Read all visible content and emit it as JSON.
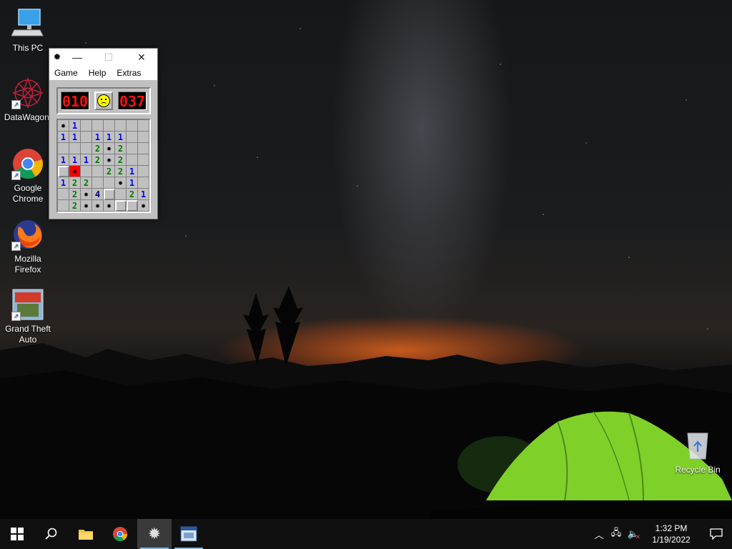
{
  "desktop": {
    "icons": [
      {
        "label": "This PC",
        "icon": "computer-icon"
      },
      {
        "label": "DataWagon.",
        "icon": "datawagon-icon"
      },
      {
        "label": "Google Chrome",
        "icon": "chrome-icon"
      },
      {
        "label": "Mozilla Firefox",
        "icon": "firefox-icon"
      },
      {
        "label": "Grand Theft Auto",
        "icon": "gta-icon"
      }
    ],
    "recycle_bin": {
      "label": "Recycle Bin",
      "icon": "recycle-bin-icon"
    }
  },
  "minesweeper": {
    "menu": [
      "Game",
      "Help",
      "Extras"
    ],
    "mines_counter": "010",
    "timer": "037",
    "face_state": "dead",
    "grid": [
      [
        "*",
        "1",
        "",
        "",
        "",
        "",
        "",
        ""
      ],
      [
        "1",
        "1",
        "",
        "1",
        "1",
        "1",
        "",
        ""
      ],
      [
        "",
        "",
        "",
        "2",
        "*",
        "2",
        "",
        ""
      ],
      [
        "1",
        "1",
        "1",
        "2",
        "*",
        "2",
        "",
        ""
      ],
      [
        "#",
        "X",
        "",
        "",
        "2",
        "2",
        "1",
        ""
      ],
      [
        "1",
        "2",
        "2",
        "",
        "",
        "*",
        "1",
        ""
      ],
      [
        "",
        "2",
        "*",
        "4",
        "#",
        "",
        "2",
        "1"
      ],
      [
        "",
        "2",
        "*",
        "*",
        "*",
        "#",
        "#",
        "*"
      ]
    ]
  },
  "taskbar": {
    "tray": {
      "time": "1:32 PM",
      "date": "1/19/2022"
    }
  },
  "colors": {
    "lcd_digits": "#ff1010",
    "exploded_cell": "#ff0000",
    "tent_green": "#7fd12a",
    "taskbar": "#101010"
  }
}
